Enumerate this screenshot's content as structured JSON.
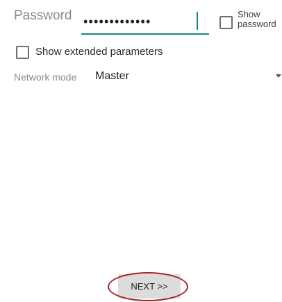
{
  "password": {
    "label": "Password",
    "value_masked": "•••••••••••••"
  },
  "show_password": {
    "label": "Show password",
    "checked": false
  },
  "extended": {
    "label": "Show extended parameters",
    "checked": false
  },
  "network_mode": {
    "label": "Network mode",
    "value": "Master"
  },
  "next_button": {
    "label": "NEXT >>"
  },
  "colors": {
    "accent": "#138a80",
    "highlight": "#a81f24"
  }
}
